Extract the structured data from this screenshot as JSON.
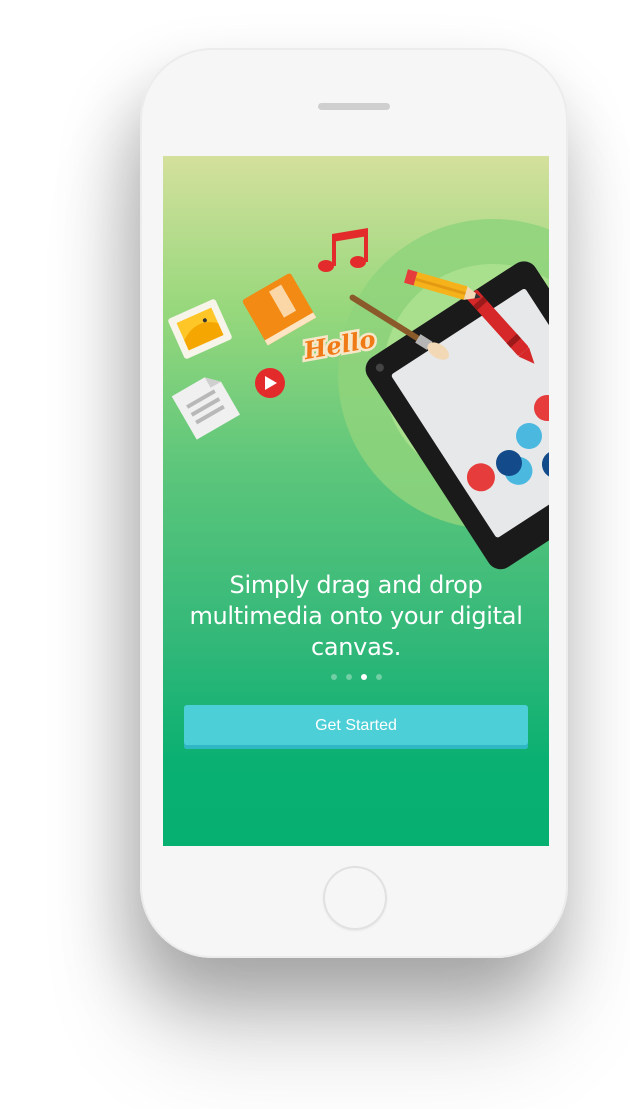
{
  "onboarding": {
    "headline": "Simply drag and drop multimedia onto your digital canvas.",
    "illustration_label": "Hello",
    "cta_label": "Get Started",
    "page_indicator": {
      "total": 4,
      "current": 3
    }
  },
  "theme": {
    "gradient_top": "#d4e09d",
    "gradient_bottom": "#06b071",
    "button_color": "#4ccfd7",
    "phone_shell": "#f6f6f6"
  },
  "icons": [
    "photo-icon",
    "book-icon",
    "music-note-icon",
    "pencil-icon",
    "paintbrush-icon",
    "crayon-icon",
    "play-icon",
    "document-icon",
    "hello-sticker-icon",
    "tablet-device-icon"
  ]
}
